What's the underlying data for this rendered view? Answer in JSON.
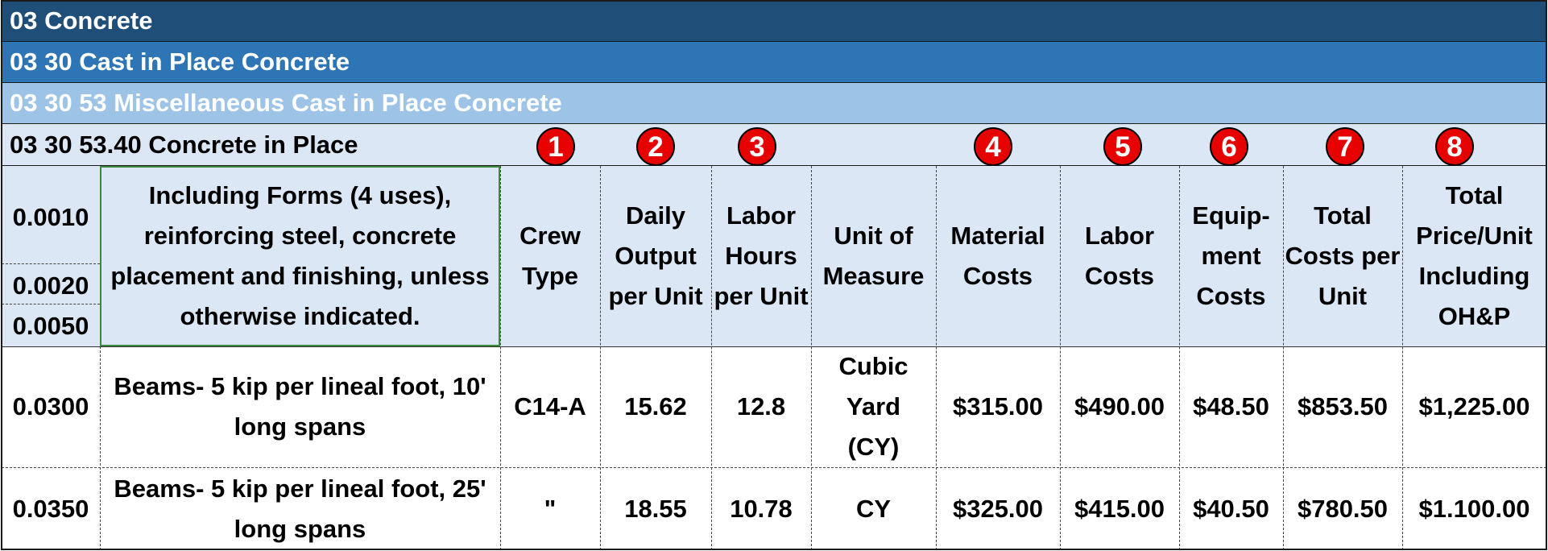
{
  "bands": {
    "division": "03 Concrete",
    "section": "03 30 Cast in Place Concrete",
    "subsection": "03 30 53 Miscellaneous Cast in Place Concrete",
    "item": "03 30 53.40 Concrete in Place"
  },
  "badges": [
    "1",
    "2",
    "3",
    "4",
    "5",
    "6",
    "7",
    "8"
  ],
  "header": {
    "codes": [
      "0.0010",
      "0.0020",
      "0.0050"
    ],
    "description": "Including Forms (4 uses), reinforcing steel, concrete placement and finishing, unless otherwise indicated.",
    "crew_type": "Crew Type",
    "daily_output": "Daily Output per Unit",
    "labor_hours": "Labor Hours per Unit",
    "unit": "Unit of Measure",
    "material": "Material Costs",
    "labor": "Labor Costs",
    "equipment": "Equip-ment Costs",
    "total": "Total Costs per Unit",
    "total_price": "Total Price/Unit Including OH&P"
  },
  "rows": [
    {
      "code": "0.0300",
      "description": "Beams- 5 kip per lineal foot, 10' long spans",
      "crew": "C14-A",
      "daily_output": "15.62",
      "labor_hours": "12.8",
      "unit": "Cubic Yard (CY)",
      "material": "$315.00",
      "labor": "$490.00",
      "equipment": "$48.50",
      "total": "$853.50",
      "total_price": "$1,225.00"
    },
    {
      "code": "0.0350",
      "description": "Beams- 5 kip per lineal foot, 25' long spans",
      "crew": "\"",
      "daily_output": "18.55",
      "labor_hours": "10.78",
      "unit": "CY",
      "material": "$325.00",
      "labor": "$415.00",
      "equipment": "$40.50",
      "total": "$780.50",
      "total_price": "$1.100.00"
    }
  ],
  "colors": {
    "division_band": "#1f4e79",
    "section_band": "#2e75b6",
    "subsection_band": "#9dc3e6",
    "header_fill": "#dbe7f4",
    "badge": "#e60000"
  }
}
